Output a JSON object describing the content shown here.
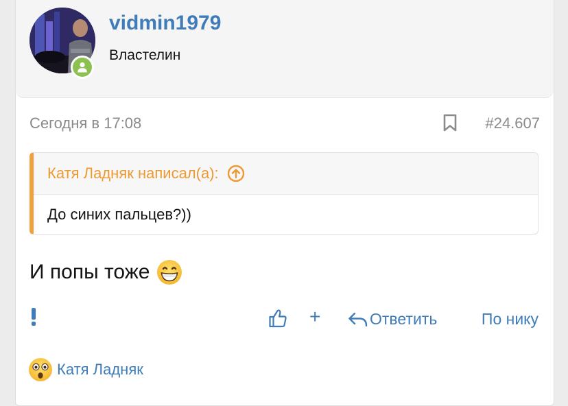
{
  "user": {
    "username": "vidmin1979",
    "title": "Властелин",
    "status": "online"
  },
  "post": {
    "date": "Сегодня в 17:08",
    "number": "#24.607",
    "quote": {
      "author_line": "Катя Ладняк написал(а):",
      "text": "До синих пальцев?))"
    },
    "message": "И попы тоже",
    "message_emoji": "grinning-face"
  },
  "actions": {
    "reply": "Ответить",
    "mention": "По нику"
  },
  "reactions": {
    "emoji": "astonished-face",
    "user": "Катя Ладняк"
  },
  "colors": {
    "link": "#3f7cb8",
    "quote_accent": "#f0a03c",
    "online": "#8cc152",
    "meta": "#8a8a8a"
  }
}
